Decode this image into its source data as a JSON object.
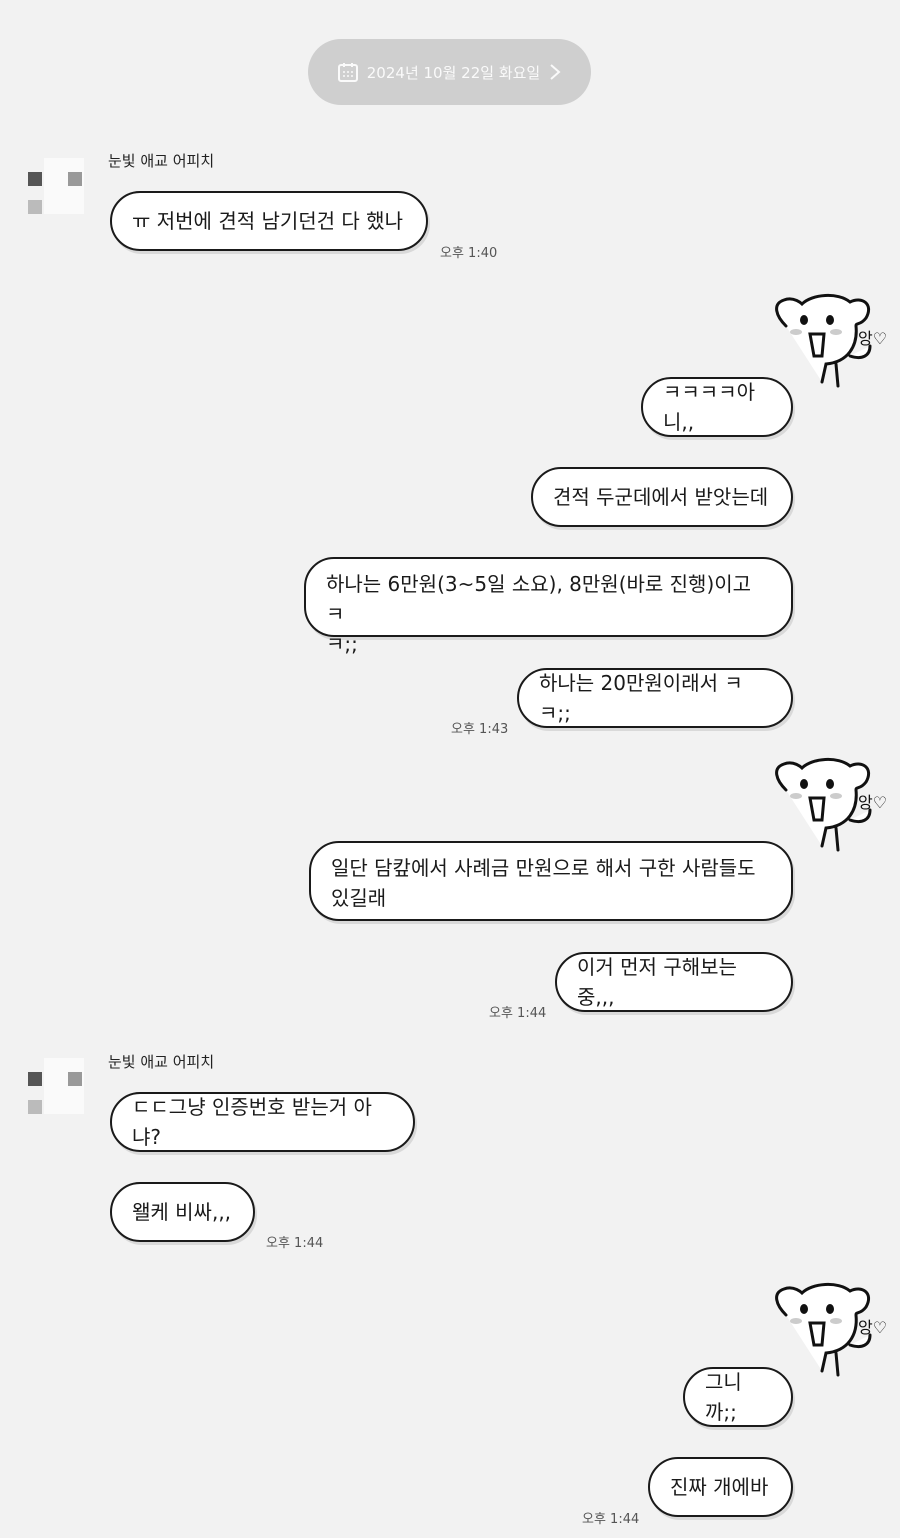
{
  "date_header": {
    "label": "2024년 10월 22일 화요일"
  },
  "sender": {
    "name": "눈빛 애교 어피치"
  },
  "messages": {
    "m1": "ㅠ 저번에 견적 남기던건 다 했나",
    "m2": "ㅋㅋㅋㅋ아니,,",
    "m3": "견적 두군데에서 받앗는데",
    "m4_line1": "하나는 6만원(3~5일 소요), 8만원(바로 진행)이고 ㅋ",
    "m4_line2": "ㅋ;;",
    "m5": "하나는 20만원이래서 ㅋㅋ;;",
    "m6_line1": "일단 담캎에서 사례금 만원으로 해서 구한 사람들도",
    "m6_line2": "있길래",
    "m7": "이거 먼저 구해보는중,,,",
    "m8": "ㄷㄷ그냥 인증번호 받는거 아냐?",
    "m9": "왤케 비싸,,,",
    "m10": "그니까;;",
    "m11": "진짜 개에바"
  },
  "times": {
    "t1": "오후 1:40",
    "t2": "오후 1:43",
    "t3": "오후 1:44",
    "t4": "오후 1:44",
    "t5": "오후 1:44"
  },
  "stickers": {
    "icon": "dog-sticker-icon",
    "text": "앙♡"
  },
  "colors": {
    "background": "#f2f2f2",
    "bubble": "#ffffff",
    "date_pill": "#cfcfcf"
  }
}
